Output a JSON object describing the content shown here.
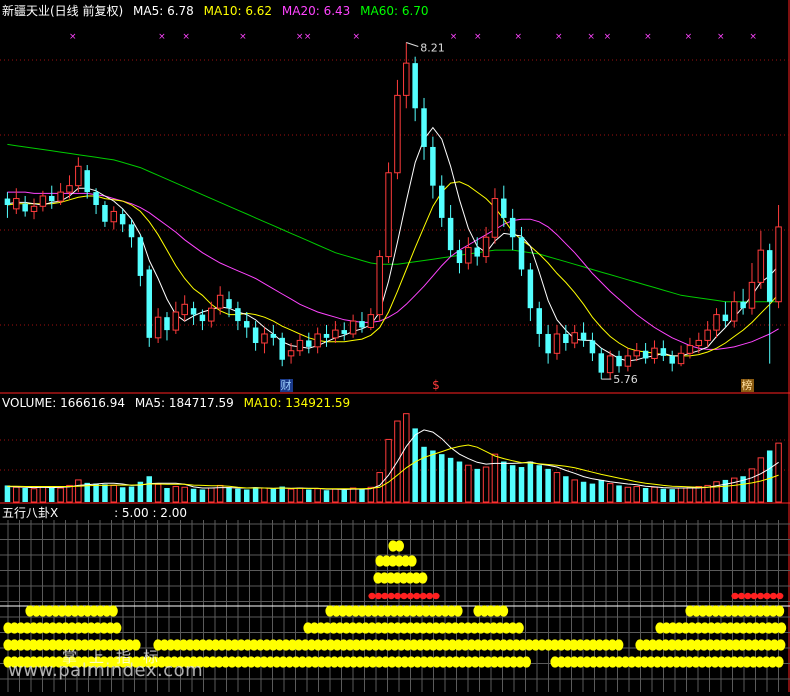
{
  "header": {
    "stock": "新疆天业(日线 前复权)",
    "ma_labels": [
      {
        "text": "MA5: 6.78",
        "color": "#ffffff"
      },
      {
        "text": "MA10: 6.62",
        "color": "#ffff00"
      },
      {
        "text": "MA20: 6.43",
        "color": "#ff44ff"
      },
      {
        "text": "MA60: 6.70",
        "color": "#00ff00"
      }
    ]
  },
  "volume_header": [
    {
      "text": "VOLUME: 166616.94",
      "color": "#ffffff"
    },
    {
      "text": "MA5: 184717.59",
      "color": "#ffffff"
    },
    {
      "text": "MA10: 134921.59",
      "color": "#ffff00"
    }
  ],
  "indicator_header": {
    "name": "五行八卦X",
    "values": ": 5.00 : 2.00"
  },
  "markers": {
    "fin": "财",
    "dollar": "$",
    "rank": "榜"
  },
  "watermark": {
    "site": "www.palmindex.com",
    "cn": "掌上指标"
  },
  "colors": {
    "up": "#ff3c3c",
    "down": "#54ffff",
    "ma5": "#ffffff",
    "ma10": "#ffff00",
    "ma20": "#ff44ff",
    "ma60": "#00cc00",
    "grid": "#ff2020",
    "dot": "#ffff00",
    "dot_red": "#ff2020"
  },
  "chart_data": {
    "type": "candlestick",
    "price_range": [
      5.5,
      8.4
    ],
    "high_label": "8.21",
    "low_label": "5.76",
    "candles": [
      [
        7.0,
        6.95,
        7.05,
        6.85
      ],
      [
        6.92,
        7.0,
        7.08,
        6.88
      ],
      [
        6.96,
        6.9,
        7.02,
        6.86
      ],
      [
        6.9,
        6.94,
        7.0,
        6.84
      ],
      [
        6.94,
        7.02,
        7.06,
        6.9
      ],
      [
        7.02,
        6.98,
        7.1,
        6.92
      ],
      [
        6.98,
        7.05,
        7.12,
        6.95
      ],
      [
        7.05,
        7.1,
        7.18,
        7.0
      ],
      [
        7.1,
        7.25,
        7.32,
        7.05
      ],
      [
        7.22,
        7.05,
        7.26,
        7.0
      ],
      [
        7.05,
        6.95,
        7.08,
        6.88
      ],
      [
        6.95,
        6.82,
        6.98,
        6.78
      ],
      [
        6.82,
        6.9,
        6.94,
        6.76
      ],
      [
        6.88,
        6.8,
        6.92,
        6.74
      ],
      [
        6.8,
        6.7,
        6.84,
        6.62
      ],
      [
        6.7,
        6.4,
        6.72,
        6.32
      ],
      [
        6.45,
        5.92,
        6.48,
        5.85
      ],
      [
        5.92,
        6.08,
        6.15,
        5.88
      ],
      [
        6.08,
        5.98,
        6.12,
        5.9
      ],
      [
        5.98,
        6.12,
        6.2,
        5.95
      ],
      [
        6.1,
        6.18,
        6.25,
        6.05
      ],
      [
        6.15,
        6.1,
        6.2,
        6.02
      ],
      [
        6.1,
        6.05,
        6.14,
        5.98
      ],
      [
        6.05,
        6.15,
        6.2,
        6.0
      ],
      [
        6.15,
        6.25,
        6.32,
        6.1
      ],
      [
        6.22,
        6.15,
        6.28,
        6.08
      ],
      [
        6.15,
        6.05,
        6.2,
        5.98
      ],
      [
        6.05,
        6.0,
        6.12,
        5.92
      ],
      [
        6.0,
        5.88,
        6.05,
        5.82
      ],
      [
        5.88,
        5.95,
        6.0,
        5.8
      ],
      [
        5.95,
        5.92,
        6.02,
        5.86
      ],
      [
        5.92,
        5.75,
        5.96,
        5.7
      ],
      [
        5.78,
        5.82,
        5.88,
        5.72
      ],
      [
        5.82,
        5.9,
        5.95,
        5.78
      ],
      [
        5.9,
        5.85,
        5.96,
        5.8
      ],
      [
        5.85,
        5.95,
        6.0,
        5.8
      ],
      [
        5.95,
        5.92,
        6.02,
        5.85
      ],
      [
        5.92,
        5.98,
        6.05,
        5.88
      ],
      [
        5.98,
        5.95,
        6.04,
        5.9
      ],
      [
        5.95,
        6.05,
        6.1,
        5.92
      ],
      [
        6.05,
        6.0,
        6.12,
        5.96
      ],
      [
        6.0,
        6.1,
        6.15,
        5.98
      ],
      [
        6.1,
        6.55,
        6.6,
        6.05
      ],
      [
        6.55,
        7.2,
        7.28,
        6.5
      ],
      [
        7.2,
        7.8,
        7.92,
        7.15
      ],
      [
        7.8,
        8.05,
        8.21,
        7.7
      ],
      [
        8.05,
        7.7,
        8.1,
        7.6
      ],
      [
        7.7,
        7.4,
        7.78,
        7.3
      ],
      [
        7.4,
        7.1,
        7.48,
        7.0
      ],
      [
        7.1,
        6.85,
        7.18,
        6.78
      ],
      [
        6.85,
        6.6,
        6.95,
        6.55
      ],
      [
        6.6,
        6.5,
        6.68,
        6.42
      ],
      [
        6.5,
        6.62,
        6.7,
        6.45
      ],
      [
        6.62,
        6.55,
        6.7,
        6.48
      ],
      [
        6.55,
        6.7,
        6.78,
        6.5
      ],
      [
        6.7,
        7.0,
        7.08,
        6.65
      ],
      [
        7.0,
        6.85,
        7.1,
        6.78
      ],
      [
        6.85,
        6.7,
        6.92,
        6.6
      ],
      [
        6.7,
        6.45,
        6.78,
        6.4
      ],
      [
        6.45,
        6.15,
        6.5,
        6.05
      ],
      [
        6.15,
        5.95,
        6.2,
        5.85
      ],
      [
        5.95,
        5.8,
        6.02,
        5.72
      ],
      [
        5.8,
        5.95,
        6.02,
        5.75
      ],
      [
        5.95,
        5.88,
        6.02,
        5.82
      ],
      [
        5.88,
        5.96,
        6.02,
        5.84
      ],
      [
        5.96,
        5.9,
        6.04,
        5.85
      ],
      [
        5.9,
        5.8,
        5.96,
        5.74
      ],
      [
        5.8,
        5.65,
        5.84,
        5.6
      ],
      [
        5.65,
        5.78,
        5.82,
        5.6
      ],
      [
        5.78,
        5.7,
        5.82,
        5.65
      ],
      [
        5.7,
        5.78,
        5.84,
        5.66
      ],
      [
        5.78,
        5.82,
        5.88,
        5.74
      ],
      [
        5.82,
        5.76,
        5.88,
        5.72
      ],
      [
        5.76,
        5.84,
        5.9,
        5.72
      ],
      [
        5.84,
        5.78,
        5.9,
        5.74
      ],
      [
        5.78,
        5.72,
        5.82,
        5.66
      ],
      [
        5.72,
        5.8,
        5.86,
        5.7
      ],
      [
        5.8,
        5.86,
        5.92,
        5.76
      ],
      [
        5.86,
        5.9,
        5.96,
        5.8
      ],
      [
        5.9,
        5.98,
        6.05,
        5.85
      ],
      [
        5.98,
        6.1,
        6.15,
        5.92
      ],
      [
        6.1,
        6.05,
        6.2,
        6.0
      ],
      [
        6.05,
        6.2,
        6.28,
        6.0
      ],
      [
        6.2,
        6.15,
        6.3,
        6.1
      ],
      [
        6.15,
        6.35,
        6.5,
        6.1
      ],
      [
        6.35,
        6.6,
        6.75,
        6.3
      ],
      [
        6.6,
        6.2,
        6.65,
        5.72
      ],
      [
        6.2,
        6.78,
        6.95,
        6.15
      ]
    ],
    "ma5": [
      6.96,
      6.97,
      6.97,
      6.96,
      6.95,
      6.97,
      6.98,
      7.02,
      7.08,
      7.08,
      7.06,
      7.02,
      6.98,
      6.92,
      6.84,
      6.72,
      6.52,
      6.38,
      6.22,
      6.1,
      6.05,
      6.09,
      6.12,
      6.14,
      6.16,
      6.15,
      6.12,
      6.1,
      6.06,
      6.0,
      5.95,
      5.89,
      5.86,
      5.85,
      5.84,
      5.86,
      5.89,
      5.92,
      5.94,
      5.97,
      5.99,
      6.02,
      6.12,
      6.36,
      6.66,
      6.98,
      7.28,
      7.46,
      7.55,
      7.46,
      7.25,
      6.99,
      6.77,
      6.63,
      6.58,
      6.67,
      6.73,
      6.72,
      6.71,
      6.63,
      6.43,
      6.21,
      6.06,
      5.98,
      5.91,
      5.9,
      5.9,
      5.84,
      5.8,
      5.76,
      5.74,
      5.75,
      5.77,
      5.78,
      5.8,
      5.78,
      5.78,
      5.8,
      5.82,
      5.85,
      5.93,
      6.0,
      6.08,
      6.16,
      6.25,
      6.35,
      6.4,
      6.48
    ],
    "ma10": [
      6.95,
      6.96,
      6.96,
      6.96,
      6.96,
      6.96,
      6.97,
      6.99,
      7.01,
      7.02,
      7.02,
      7.0,
      6.99,
      6.98,
      6.95,
      6.9,
      6.82,
      6.72,
      6.6,
      6.48,
      6.38,
      6.3,
      6.25,
      6.18,
      6.13,
      6.1,
      6.1,
      6.11,
      6.1,
      6.08,
      6.05,
      6.01,
      5.98,
      5.95,
      5.92,
      5.9,
      5.89,
      5.89,
      5.89,
      5.9,
      5.91,
      5.94,
      6.0,
      6.12,
      6.28,
      6.45,
      6.62,
      6.78,
      6.94,
      7.05,
      7.12,
      7.13,
      7.1,
      7.05,
      7.0,
      6.93,
      6.84,
      6.74,
      6.68,
      6.63,
      6.57,
      6.5,
      6.42,
      6.35,
      6.27,
      6.18,
      6.08,
      6.0,
      5.93,
      5.88,
      5.84,
      5.82,
      5.81,
      5.8,
      5.79,
      5.78,
      5.78,
      5.78,
      5.79,
      5.81,
      5.84,
      5.88,
      5.93,
      5.98,
      6.04,
      6.11,
      6.18,
      6.26
    ],
    "ma20": [
      7.05,
      7.05,
      7.05,
      7.04,
      7.04,
      7.04,
      7.04,
      7.04,
      7.04,
      7.04,
      7.03,
      7.02,
      7.0,
      6.98,
      6.96,
      6.93,
      6.89,
      6.84,
      6.79,
      6.74,
      6.68,
      6.63,
      6.58,
      6.54,
      6.5,
      6.47,
      6.44,
      6.41,
      6.38,
      6.34,
      6.3,
      6.26,
      6.22,
      6.18,
      6.15,
      6.12,
      6.1,
      6.08,
      6.06,
      6.05,
      6.04,
      6.04,
      6.05,
      6.08,
      6.12,
      6.18,
      6.25,
      6.32,
      6.4,
      6.48,
      6.55,
      6.6,
      6.64,
      6.68,
      6.72,
      6.76,
      6.8,
      6.83,
      6.84,
      6.84,
      6.82,
      6.78,
      6.72,
      6.65,
      6.58,
      6.5,
      6.42,
      6.35,
      6.28,
      6.22,
      6.16,
      6.1,
      6.05,
      6.0,
      5.96,
      5.92,
      5.89,
      5.86,
      5.84,
      5.83,
      5.83,
      5.84,
      5.85,
      5.87,
      5.89,
      5.92,
      5.95,
      5.99
    ],
    "ma60": [
      7.42,
      7.41,
      7.4,
      7.39,
      7.38,
      7.37,
      7.36,
      7.35,
      7.34,
      7.33,
      7.32,
      7.31,
      7.3,
      7.28,
      7.26,
      7.24,
      7.21,
      7.18,
      7.15,
      7.12,
      7.09,
      7.06,
      7.03,
      7.0,
      6.97,
      6.94,
      6.91,
      6.88,
      6.85,
      6.82,
      6.79,
      6.76,
      6.73,
      6.7,
      6.67,
      6.64,
      6.61,
      6.58,
      6.56,
      6.54,
      6.52,
      6.5,
      6.49,
      6.49,
      6.49,
      6.5,
      6.51,
      6.52,
      6.53,
      6.54,
      6.55,
      6.56,
      6.57,
      6.58,
      6.59,
      6.6,
      6.6,
      6.6,
      6.59,
      6.58,
      6.57,
      6.55,
      6.53,
      6.51,
      6.49,
      6.47,
      6.45,
      6.43,
      6.41,
      6.39,
      6.37,
      6.35,
      6.33,
      6.31,
      6.29,
      6.27,
      6.25,
      6.24,
      6.23,
      6.22,
      6.21,
      6.2,
      6.2,
      6.2,
      6.2,
      6.2,
      6.2,
      6.2
    ],
    "volume_range": [
      0,
      250000
    ],
    "volume": [
      45000,
      40000,
      38000,
      36000,
      42000,
      40000,
      38000,
      45000,
      60000,
      52000,
      50000,
      48000,
      45000,
      40000,
      42000,
      55000,
      70000,
      48000,
      38000,
      42000,
      40000,
      36000,
      34000,
      38000,
      45000,
      40000,
      36000,
      34000,
      40000,
      38000,
      36000,
      42000,
      35000,
      38000,
      34000,
      36000,
      32000,
      35000,
      33000,
      38000,
      36000,
      40000,
      80000,
      170000,
      220000,
      240000,
      200000,
      150000,
      140000,
      130000,
      120000,
      110000,
      100000,
      90000,
      95000,
      130000,
      110000,
      100000,
      95000,
      110000,
      100000,
      90000,
      80000,
      70000,
      60000,
      55000,
      50000,
      60000,
      50000,
      45000,
      40000,
      42000,
      38000,
      40000,
      36000,
      35000,
      38000,
      40000,
      42000,
      45000,
      55000,
      60000,
      65000,
      70000,
      90000,
      120000,
      140000,
      160000
    ],
    "vol_ma5": [
      42000,
      41000,
      40000,
      39000,
      40000,
      39000,
      40000,
      41000,
      45000,
      47000,
      49000,
      51000,
      51000,
      49000,
      45000,
      46000,
      50000,
      51000,
      51000,
      51000,
      48000,
      41000,
      38000,
      38000,
      39000,
      39000,
      38000,
      38000,
      39000,
      38000,
      37000,
      38000,
      37000,
      38000,
      37000,
      37000,
      35000,
      35000,
      34000,
      35000,
      35000,
      36000,
      45000,
      73000,
      110000,
      151000,
      182000,
      196000,
      190000,
      172000,
      148000,
      130000,
      118000,
      108000,
      103000,
      105000,
      105000,
      105000,
      106000,
      109000,
      103000,
      100000,
      95000,
      86000,
      78000,
      69000,
      63000,
      59000,
      55000,
      52000,
      49000,
      47000,
      43000,
      41000,
      39000,
      38000,
      38000,
      38000,
      38000,
      40000,
      44000,
      48000,
      53000,
      59000,
      66000,
      77000,
      91000,
      108000
    ],
    "vol_ma10": [
      43000,
      43000,
      42000,
      42000,
      42000,
      42000,
      42000,
      42000,
      43000,
      44000,
      45000,
      45000,
      46000,
      46000,
      46000,
      47000,
      49000,
      49000,
      48000,
      48000,
      48000,
      46000,
      45000,
      44000,
      44000,
      43000,
      40000,
      38000,
      38000,
      38000,
      37000,
      38000,
      37000,
      37000,
      37000,
      37000,
      36000,
      36000,
      36000,
      36000,
      36000,
      37000,
      40000,
      54000,
      73000,
      93000,
      109000,
      121000,
      129000,
      137000,
      145000,
      151000,
      155000,
      149000,
      137000,
      125000,
      118000,
      112000,
      107000,
      106000,
      104000,
      102000,
      100000,
      97000,
      93000,
      87000,
      81000,
      75000,
      70000,
      65000,
      60000,
      55000,
      51000,
      48000,
      45000,
      43000,
      42000,
      41000,
      40000,
      40000,
      41000,
      43000,
      45000,
      48000,
      52000,
      57000,
      64000,
      73000
    ]
  }
}
